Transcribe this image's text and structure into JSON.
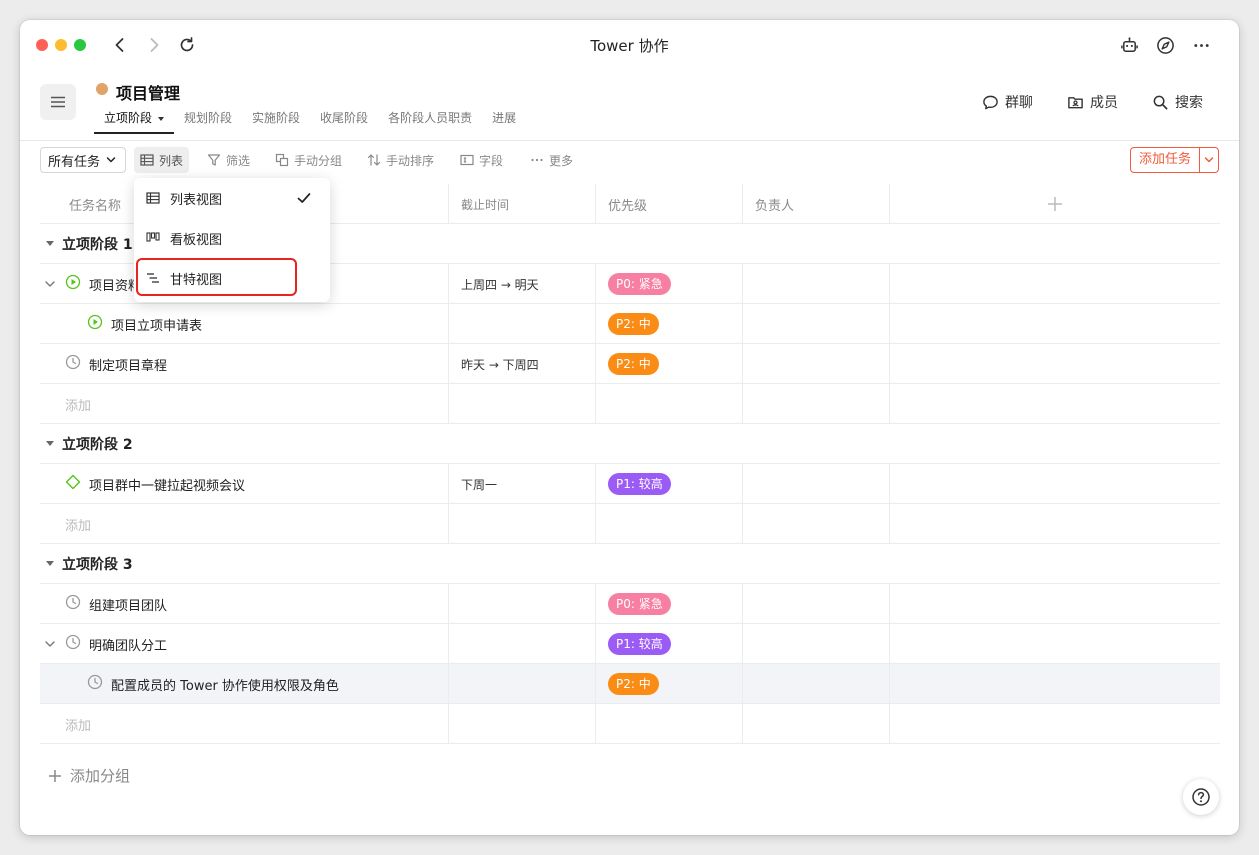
{
  "window": {
    "title": "Tower 协作"
  },
  "project": {
    "title": "项目管理",
    "dot_color": "#e0a36a",
    "tabs": [
      "立项阶段",
      "规划阶段",
      "实施阶段",
      "收尾阶段",
      "各阶段人员职责",
      "进展"
    ],
    "actions": {
      "chat": "群聊",
      "members": "成员",
      "search": "搜索"
    }
  },
  "toolbar": {
    "filter_select": "所有任务",
    "view": "列表",
    "filter": "筛选",
    "group": "手动分组",
    "sort": "手动排序",
    "fields": "字段",
    "more": "更多",
    "add_task": "添加任务"
  },
  "dropdown": {
    "items": [
      "列表视图",
      "看板视图",
      "甘特视图"
    ],
    "selected": "列表视图",
    "highlighted": "甘特视图"
  },
  "table": {
    "columns": [
      "任务名称",
      "截止时间",
      "优先级",
      "负责人"
    ],
    "add_label": "添加",
    "add_group": "添加分组",
    "groups": [
      {
        "name": "立项阶段 1",
        "rows": [
          {
            "name": "项目资料",
            "due": "上周四 → 明天",
            "priority": "P0: 紧急"
          },
          {
            "name": "项目立项申请表",
            "due": "",
            "priority": "P2: 中"
          },
          {
            "name": "制定项目章程",
            "due": "昨天 → 下周四",
            "priority": "P2: 中"
          }
        ]
      },
      {
        "name": "立项阶段 2",
        "rows": [
          {
            "name": "项目群中一键拉起视频会议",
            "due": "下周一",
            "priority": "P1: 较高"
          }
        ]
      },
      {
        "name": "立项阶段 3",
        "rows": [
          {
            "name": "组建项目团队",
            "due": "",
            "priority": "P0: 紧急"
          },
          {
            "name": "明确团队分工",
            "due": "",
            "priority": "P1: 较高"
          },
          {
            "name": "配置成员的 Tower 协作使用权限及角色",
            "due": "",
            "priority": "P2: 中"
          }
        ]
      }
    ]
  },
  "colors": {
    "p0": "#f77fa3",
    "p1": "#9b5cf6",
    "p2": "#fa8c16",
    "accent": "#f25a3b",
    "green": "#52c41a"
  }
}
